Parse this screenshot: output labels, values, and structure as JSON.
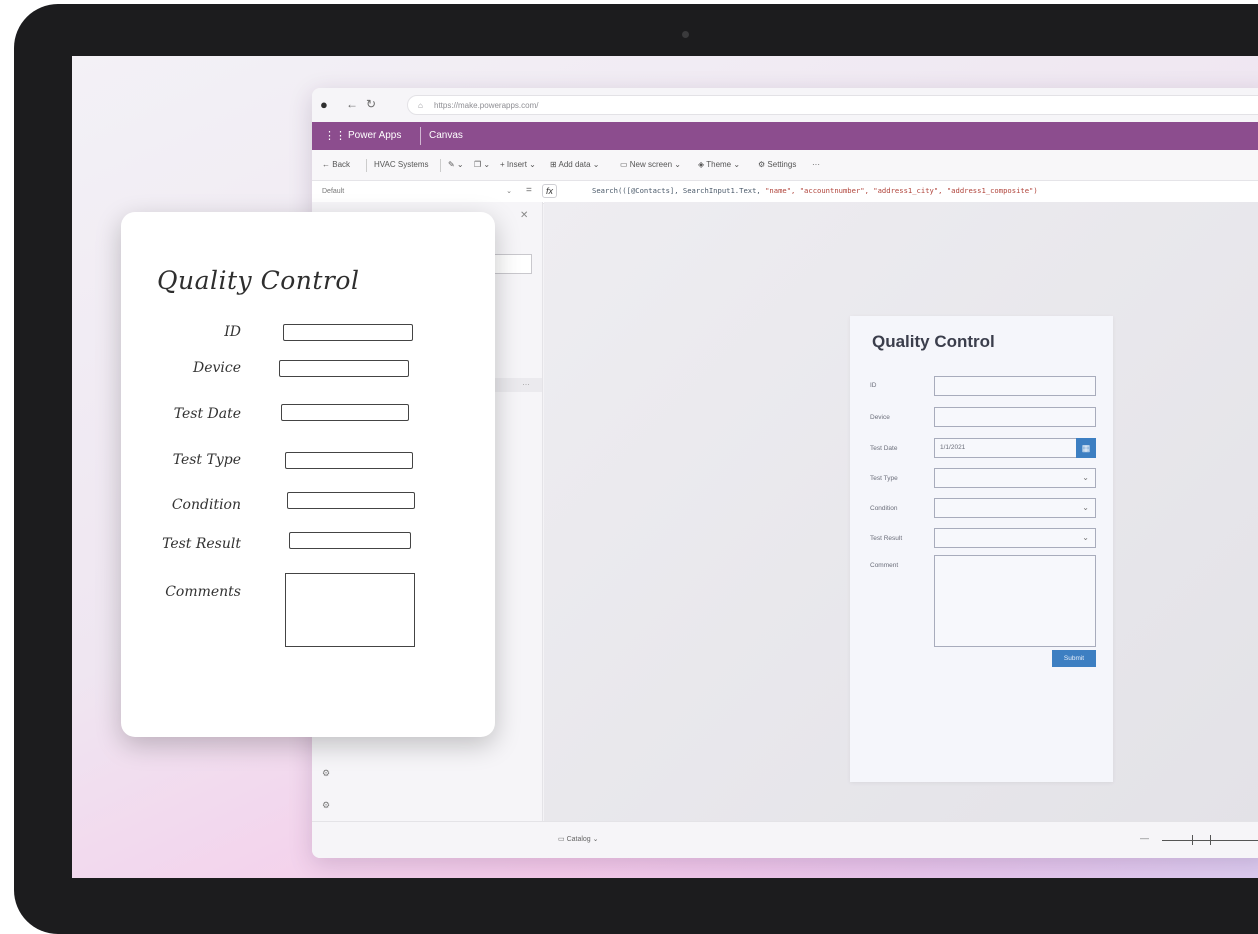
{
  "browser": {
    "url": "https://make.powerapps.com/"
  },
  "appbar": {
    "app_name": "Power Apps",
    "section": "Canvas"
  },
  "toolbar": {
    "back": "Back",
    "app_title": "HVAC Systems",
    "insert": "Insert",
    "add_data": "Add data",
    "new_screen": "New screen",
    "theme": "Theme",
    "settings": "Settings",
    "more": "···"
  },
  "formula_bar": {
    "property": "Default",
    "equals": "=",
    "fx": "fx",
    "formula_prefix": "Search(([@Contacts], SearchInput1.Text, ",
    "formula_args": "\"name\", \"accountnumber\", \"address1_city\", \"address1_composite\")"
  },
  "statusbar": {
    "category": "Catalog"
  },
  "app_form": {
    "title": "Quality Control",
    "fields": [
      {
        "label": "ID",
        "value": ""
      },
      {
        "label": "Device",
        "value": ""
      },
      {
        "label": "Test Date",
        "value": "1/1/2021"
      },
      {
        "label": "Test Type",
        "value": ""
      },
      {
        "label": "Condition",
        "value": ""
      },
      {
        "label": "Test Result",
        "value": ""
      },
      {
        "label": "Comment",
        "value": ""
      }
    ],
    "submit": "Submit"
  },
  "sketch": {
    "title": "Quality Control",
    "labels": [
      "ID",
      "Device",
      "Test Date",
      "Test Type",
      "Condition",
      "Test Result",
      "Comments"
    ]
  },
  "colors": {
    "app_bar": "#8c4d8e",
    "accent_blue": "#3d7fc2"
  }
}
